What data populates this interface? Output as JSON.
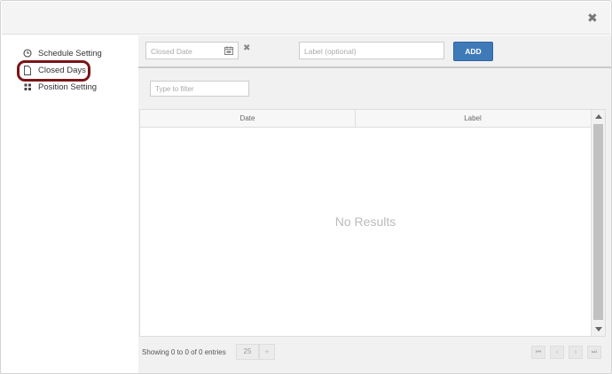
{
  "header": {
    "close_label": "✖"
  },
  "sidebar": {
    "items": [
      {
        "label": "Schedule Setting",
        "icon": "clock-icon"
      },
      {
        "label": "Closed Days",
        "icon": "document-icon",
        "active": true
      },
      {
        "label": "Position Setting",
        "icon": "grid-icon"
      }
    ]
  },
  "toolbar": {
    "date_placeholder": "Closed Date",
    "clear_label": "✖",
    "label_placeholder": "Label (optional)",
    "add_label": "ADD"
  },
  "filter": {
    "placeholder": "Type to filter"
  },
  "table": {
    "columns": [
      "Date",
      "Label"
    ],
    "empty_message": "No Results"
  },
  "footer": {
    "entries_text": "Showing 0 to 0 of 0 entries",
    "page_size": "25",
    "page_size_spin": "+",
    "pager_labels": [
      "⏮",
      "‹",
      "›",
      "⏭"
    ]
  },
  "colors": {
    "accent": "#3f7ab8",
    "highlight_ring": "#7a1418"
  }
}
